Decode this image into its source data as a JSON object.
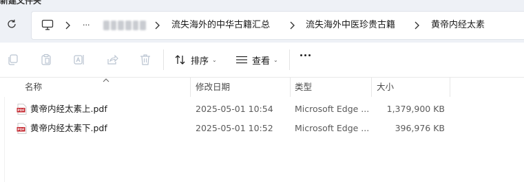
{
  "window": {
    "title_fragment": "新建文件夹"
  },
  "toolbar_icons": [
    "copy-icon",
    "paste-icon",
    "rename-icon",
    "share-icon",
    "delete-icon"
  ],
  "address_bar": {
    "crumbs": [
      "流失海外的中华古籍汇总",
      "流失海外中医珍贵古籍",
      "黄帝内经太素"
    ],
    "overflow_label": "···"
  },
  "toolbar": {
    "sort_label": "排序",
    "view_label": "查看"
  },
  "columns": {
    "name": "名称",
    "modified": "修改日期",
    "type": "类型",
    "size": "大小"
  },
  "files": [
    {
      "name": "黄帝内经太素上.pdf",
      "modified": "2025-05-01 10:54",
      "type": "Microsoft Edge ...",
      "size": "1,379,900 KB"
    },
    {
      "name": "黄帝内经太素下.pdf",
      "modified": "2025-05-01 10:52",
      "type": "Microsoft Edge ...",
      "size": "396,976 KB"
    }
  ],
  "colors": {
    "accent": "#0067c0",
    "pdf_red": "#c4262e",
    "chrome_bg": "#eef1f6"
  }
}
